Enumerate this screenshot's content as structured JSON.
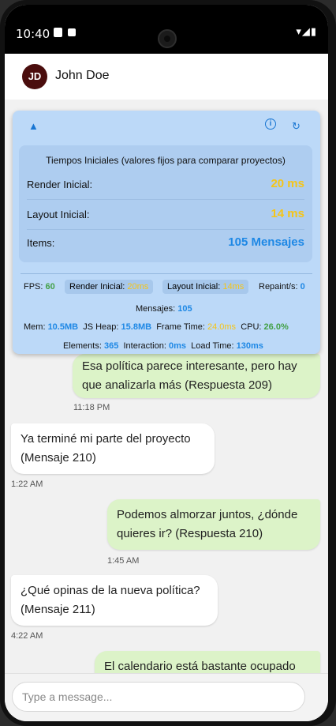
{
  "status": {
    "time": "10:40"
  },
  "header": {
    "avatar_initials": "JD",
    "contact_name": "John Doe"
  },
  "perf": {
    "toggle_icon": "▲",
    "info_icon": "i",
    "refresh_icon": "↻",
    "title": "Tiempos Iniciales (valores fijos para comparar proyectos)",
    "rows": [
      {
        "label": "Render Inicial:",
        "value": "20 ms",
        "color": "#f5c518"
      },
      {
        "label": "Layout Inicial:",
        "value": "14 ms",
        "color": "#f5c518"
      },
      {
        "label": "Items:",
        "value": "105 Mensajes",
        "color": "#1e88e5"
      }
    ],
    "metrics": {
      "fps_label": "FPS:",
      "fps": "60",
      "render_label": "Render Inicial:",
      "render": "20ms",
      "layout_label": "Layout Inicial:",
      "layout": "14ms",
      "repaint_label": "Repaint/s:",
      "repaint": "0",
      "mensajes_label": "Mensajes:",
      "mensajes": "105",
      "mem_label": "Mem:",
      "mem": "10.5MB",
      "heap_label": "JS Heap:",
      "heap": "15.8MB",
      "frame_label": "Frame Time:",
      "frame": "24.0ms",
      "cpu_label": "CPU:",
      "cpu": "26.0%",
      "elements_label": "Elements:",
      "elements": "365",
      "interaction_label": "Interaction:",
      "interaction": "0ms",
      "load_label": "Load Time:",
      "load": "130ms"
    }
  },
  "messages": [
    {
      "type": "sent",
      "text": "Esa política parece interesante, pero hay que analizarla más (Respuesta 209)",
      "time": "11:18 PM"
    },
    {
      "type": "recv",
      "text": "Ya terminé mi parte del proyecto (Mensaje 210)",
      "time": "1:22 AM"
    },
    {
      "type": "sent",
      "text": "Podemos almorzar juntos, ¿dónde quieres ir? (Respuesta 210)",
      "time": "1:45 AM"
    },
    {
      "type": "recv",
      "text": "¿Qué opinas de la nueva política? (Mensaje 211)",
      "time": "4:22 AM"
    },
    {
      "type": "sent",
      "text": "El calendario está bastante ocupado",
      "time": ""
    }
  ],
  "composer": {
    "placeholder": "Type a message..."
  }
}
